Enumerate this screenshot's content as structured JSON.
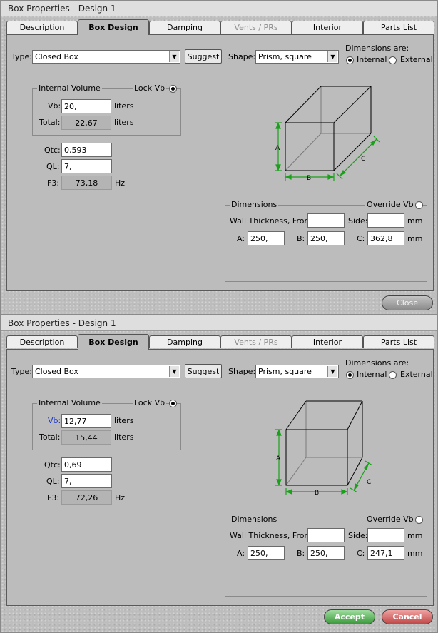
{
  "windows": [
    {
      "title": "Box Properties - Design 1",
      "tabs": [
        "Description",
        "Box Design",
        "Damping",
        "Vents / PRs",
        "Interior",
        "Parts List"
      ],
      "type_label": "Type:",
      "type_value": "Closed Box",
      "suggest_label": "Suggest",
      "shape_label": "Shape:",
      "shape_value": "Prism, square",
      "dims_are_label": "Dimensions are:",
      "internal_label": "Internal",
      "external_label": "External",
      "volume_group_title": "Internal Volume",
      "lock_vb_label": "Lock Vb",
      "vb_label": "Vb:",
      "vb_value": "20,",
      "vb_unit": "liters",
      "total_label": "Total:",
      "total_value": "22,67",
      "total_unit": "liters",
      "qtc_label": "Qtc:",
      "qtc_value": "0,593",
      "ql_label": "QL:",
      "ql_value": "7,",
      "f3_label": "F3:",
      "f3_value": "73,18",
      "f3_unit": "Hz",
      "diagram_labels": {
        "a": "A",
        "b": "B",
        "c": "C"
      },
      "dims_group_title": "Dimensions",
      "override_vb_label": "Override Vb",
      "wall_front_label": "Wall Thickness, Front:",
      "wall_front_value": "",
      "side_label": "Side:",
      "side_value": "",
      "mm1": "mm",
      "a_label": "A:",
      "a_value": "250,",
      "b_label": "B:",
      "b_value": "250,",
      "c_label": "C:",
      "c_value": "362,8",
      "mm2": "mm",
      "buttons": {
        "close": "Close"
      }
    },
    {
      "title": "Box Properties - Design 1",
      "tabs": [
        "Description",
        "Box Design",
        "Damping",
        "Vents / PRs",
        "Interior",
        "Parts List"
      ],
      "type_label": "Type:",
      "type_value": "Closed Box",
      "suggest_label": "Suggest",
      "shape_label": "Shape:",
      "shape_value": "Prism, square",
      "dims_are_label": "Dimensions are:",
      "internal_label": "Internal",
      "external_label": "External",
      "volume_group_title": "Internal Volume",
      "lock_vb_label": "Lock Vb",
      "vb_label": "Vb:",
      "vb_value": "12,77",
      "vb_unit": "liters",
      "total_label": "Total:",
      "total_value": "15,44",
      "total_unit": "liters",
      "qtc_label": "Qtc:",
      "qtc_value": "0,69",
      "ql_label": "QL:",
      "ql_value": "7,",
      "f3_label": "F3:",
      "f3_value": "72,26",
      "f3_unit": "Hz",
      "diagram_labels": {
        "a": "A",
        "b": "B",
        "c": "C"
      },
      "dims_group_title": "Dimensions",
      "override_vb_label": "Override Vb",
      "wall_front_label": "Wall Thickness, Front:",
      "wall_front_value": "",
      "side_label": "Side:",
      "side_value": "",
      "mm1": "mm",
      "a_label": "A:",
      "a_value": "250,",
      "b_label": "B:",
      "b_value": "250,",
      "c_label": "C:",
      "c_value": "247,1",
      "mm2": "mm",
      "buttons": {
        "accept": "Accept",
        "cancel": "Cancel"
      }
    }
  ],
  "colors": {
    "dimension_green": "#1aa01a",
    "changed_label_blue": "#1a37c8"
  }
}
